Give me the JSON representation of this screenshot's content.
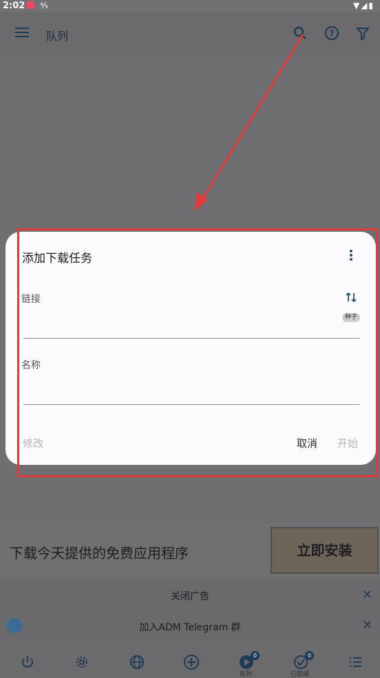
{
  "status_bar": {
    "time": "2:02",
    "notif_label": "⁴⁄₅"
  },
  "app_bar": {
    "title": "队列"
  },
  "dialog": {
    "title": "添加下载任务",
    "link_label": "链接",
    "torrent_label": "种子",
    "name_label": "名称",
    "link_value": "",
    "name_value": "",
    "modify_label": "修改",
    "cancel_label": "取消",
    "start_label": "开始"
  },
  "ad": {
    "text": "下载今天提供的免费应用程序",
    "install_label": "立即安装",
    "close_ad_label": "关闭广告"
  },
  "telegram": {
    "text": "加入ADM Telegram 群"
  },
  "bottom_nav": {
    "queue_label": "队列",
    "queue_count": "0",
    "done_label": "已完成",
    "done_count": "0"
  },
  "colors": {
    "accent": "#1f3a55",
    "highlight": "#e23a3a"
  }
}
